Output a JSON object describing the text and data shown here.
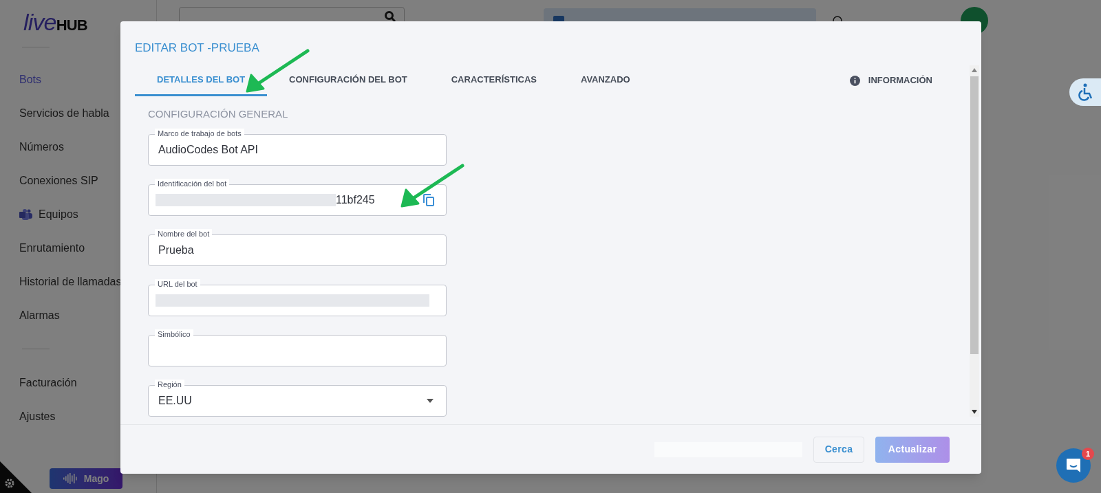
{
  "sidebar": {
    "logo": [
      "live",
      "HUB"
    ],
    "items": [
      {
        "label": "Bots",
        "selected": true,
        "has_icon": false
      },
      {
        "label": "Servicios de habla",
        "selected": false,
        "has_icon": false
      },
      {
        "label": "Números",
        "selected": false,
        "has_icon": false
      },
      {
        "label": "Conexiones SIP",
        "selected": false,
        "has_icon": false
      },
      {
        "label": "Equipos",
        "selected": false,
        "has_icon": true
      },
      {
        "label": "Enrutamiento",
        "selected": false,
        "has_icon": false
      },
      {
        "label": "Historial de llamadas",
        "selected": false,
        "has_icon": false
      },
      {
        "label": "Alarmas",
        "selected": false,
        "has_icon": false
      }
    ],
    "bottom_items": [
      {
        "label": "Facturación",
        "selected": false
      },
      {
        "label": "Ajustes",
        "selected": false
      }
    ],
    "wizard_button": "Mago"
  },
  "dialog": {
    "title": "EDITAR BOT -PRUEBA",
    "tabs": [
      {
        "label": "DETALLES DEL BOT",
        "selected": true
      },
      {
        "label": "CONFIGURACIÓN DEL BOT",
        "selected": false
      },
      {
        "label": "CARACTERÍSTICAS",
        "selected": false
      },
      {
        "label": "AVANZADO",
        "selected": false
      }
    ],
    "info_link": "INFORMACIÓN",
    "section": "CONFIGURACIÓN GENERAL",
    "fields": [
      {
        "label": "Marco de trabajo de bots",
        "kind": "text",
        "value": "AudioCodes Bot API"
      },
      {
        "label": "Identificación del bot",
        "kind": "copy",
        "masked": true,
        "value": "11bf245"
      },
      {
        "label": "Nombre del bot",
        "kind": "text",
        "value": "Prueba"
      },
      {
        "label": "URL del bot",
        "kind": "text",
        "masked": true
      },
      {
        "label": "Simbólico",
        "kind": "text"
      },
      {
        "label": "Región",
        "kind": "select",
        "value": "EE.UU"
      }
    ],
    "buttons": [
      {
        "label": "Cerca",
        "kind": "secondary",
        "disabled": false
      },
      {
        "label": "Actualizar",
        "kind": "primary",
        "disabled": true
      }
    ]
  },
  "chat": {
    "badge": "1"
  }
}
